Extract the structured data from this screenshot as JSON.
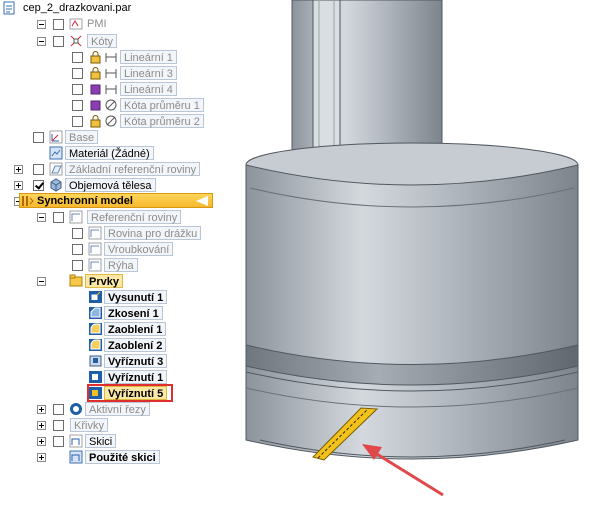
{
  "tree": {
    "root": "cep_2_drazkovani.par",
    "pmi": "PMI",
    "koty": "Kóty",
    "dimensions": [
      "Lineární 1",
      "Lineární 3",
      "Lineární 4",
      "Kóta průměru 1",
      "Kóta průměru 2"
    ],
    "base": "Base",
    "material": "Materiál (Žádné)",
    "ref_planes_base": "Základní referenční roviny",
    "bodies": "Objemová tělesa",
    "sync_model": "Synchronní model",
    "ref_planes": "Referenční roviny",
    "planes": [
      "Rovina pro drážku",
      "Vroubkování",
      "Rýha"
    ],
    "features_group": "Prvky",
    "features": [
      "Vysunutí 1",
      "Zkosení 1",
      "Zaoblení 1",
      "Zaoblení 2",
      "Vyříznutí 3",
      "Vyříznutí 1",
      "Vyříznutí 5"
    ],
    "active_sections": "Aktivní řezy",
    "curves": "Křivky",
    "sketches": "Skici",
    "used_sketches": "Použité skici"
  },
  "icons": {
    "part": "part-file-icon",
    "pmi": "pmi-icon",
    "dimension": "dimension-icon",
    "lock": "lock-icon",
    "base": "coordinate-system-icon",
    "material": "material-icon",
    "body": "solid-body-icon",
    "sync": "synchronous-icon",
    "plane": "reference-plane-icon",
    "feature": "feature-icon",
    "section": "live-section-icon",
    "curve": "curve-icon",
    "sketch": "sketch-icon"
  },
  "colors": {
    "sync_highlight": "#f7c23b",
    "selection_box": "#e02d2d",
    "slot_highlight": "#f2c21b",
    "arrow": "#e0484b"
  }
}
